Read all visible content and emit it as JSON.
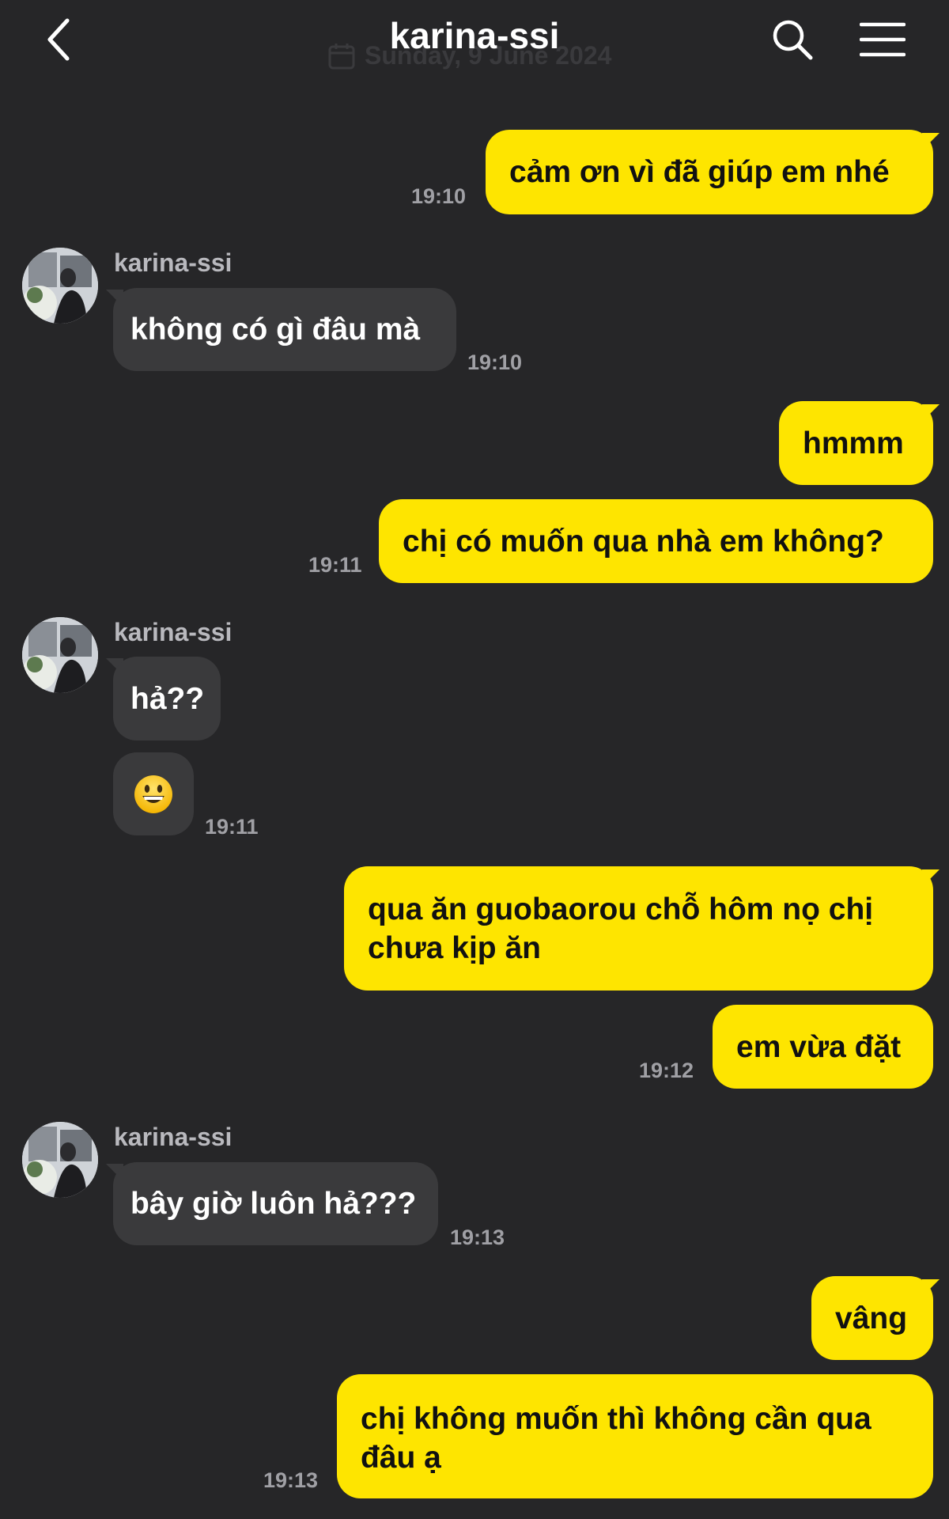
{
  "header": {
    "title": "karina-ssi",
    "date_banner": "Sunday, 9 June 2024"
  },
  "colors": {
    "background": "#262628",
    "outgoing_bubble": "#FEE500",
    "incoming_bubble": "#3a3a3c",
    "timestamp": "#a0a0a5"
  },
  "icons": {
    "back": "chevron-left-icon",
    "search": "search-icon",
    "menu": "hamburger-menu-icon",
    "calendar": "calendar-icon"
  },
  "messages": [
    {
      "direction": "out",
      "text": "cảm ơn vì đã giúp em nhé",
      "time": "19:10"
    },
    {
      "direction": "in",
      "sender": "karina-ssi",
      "text": "không có gì đâu mà",
      "time": "19:10"
    },
    {
      "direction": "out",
      "text": "hmmm"
    },
    {
      "direction": "out",
      "text": "chị có muốn qua nhà em không?",
      "time": "19:11"
    },
    {
      "direction": "in",
      "sender": "karina-ssi",
      "text": "hả??"
    },
    {
      "direction": "in",
      "text": "😀",
      "time": "19:11"
    },
    {
      "direction": "out",
      "lines": [
        "qua ăn guobaorou chỗ hôm nọ chị",
        "chưa kịp ăn"
      ]
    },
    {
      "direction": "out",
      "text": "em vừa đặt",
      "time": "19:12"
    },
    {
      "direction": "in",
      "sender": "karina-ssi",
      "text": "bây giờ luôn hả???",
      "time": "19:13"
    },
    {
      "direction": "out",
      "text": "vâng"
    },
    {
      "direction": "out",
      "lines": [
        "chị không muốn thì không cần qua",
        "đâu ạ"
      ],
      "time": "19:13"
    }
  ]
}
